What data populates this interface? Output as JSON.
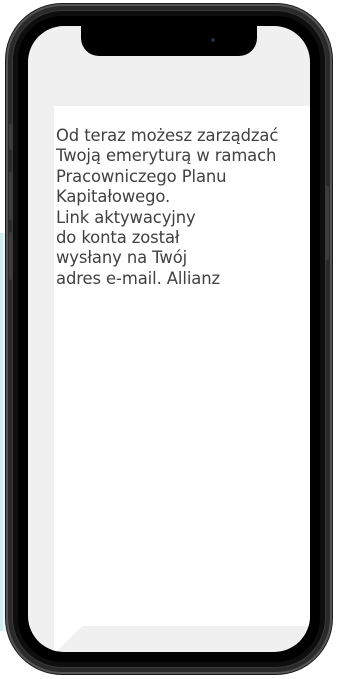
{
  "message": {
    "text": "Od teraz możesz zarządzać\nTwoją emeryturą w ramach\nPracowniczego Planu\nKapitałowego.\nLink aktywacyjny\ndo konta został\nwysłany na Twój\nadres e-mail. Allianz"
  },
  "colors": {
    "screen_background": "#f0f0f0",
    "bubble_background": "#ffffff",
    "text": "#414141",
    "side_panel": "#e8f6f7",
    "phone_body": "#000000"
  },
  "icons": {
    "front_camera": "camera-icon"
  }
}
